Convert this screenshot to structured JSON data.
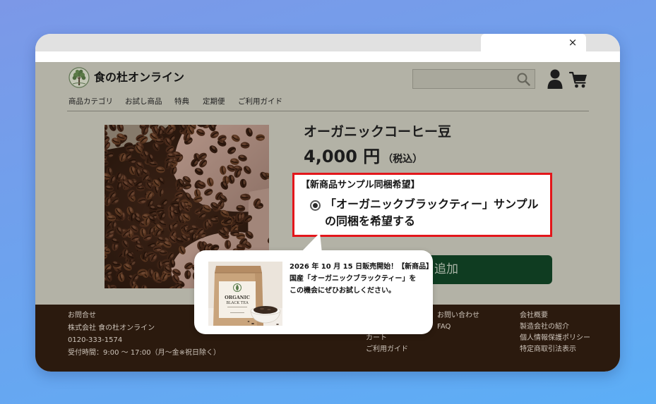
{
  "browser": {
    "close_glyph": "×",
    "close_icon": "close-icon"
  },
  "header": {
    "site_name": "食の杜オンライン",
    "logo_icon": "tree-logo-icon",
    "search_icon": "search-icon",
    "user_icon": "user-icon",
    "cart_icon": "cart-icon"
  },
  "nav": [
    {
      "label": "商品カテゴリ"
    },
    {
      "label": "お試し商品"
    },
    {
      "label": "特典"
    },
    {
      "label": "定期便"
    },
    {
      "label": "ご利用ガイド"
    }
  ],
  "product": {
    "title": "オーガニックコーヒー豆",
    "price": "4,000 円",
    "tax_note": "（税込）",
    "image": "coffee-beans-in-hands"
  },
  "sample_option": {
    "heading": "【新商品サンプル同梱希望】",
    "label_line1": "「オーガニックブラックティー」サンプル",
    "label_line2": "の同梱を希望する",
    "selected": true
  },
  "cart_button": {
    "label": "追加"
  },
  "callout": {
    "lines": [
      "2026 年 10 月 15 日販売開始！【新商品】",
      "国産「オーガニックブラックティー」を",
      "この機会にぜひお試しください。"
    ],
    "package_text": [
      "ORGANIC",
      "BLACK TEA"
    ]
  },
  "footer": {
    "contact": [
      "お問合せ",
      "株式会社 食の杜オンライン",
      "0120-333-1574",
      "受付時間：9:00 〜 17:00（月〜金※祝日除く）"
    ],
    "links_col2": [
      "カート",
      "ご利用ガイド"
    ],
    "links_col3": [
      "お問い合わせ",
      "FAQ"
    ],
    "links_col4": [
      "会社概要",
      "製造会社の紹介",
      "個人情報保護ポリシー",
      "特定商取引法表示"
    ]
  },
  "colors": {
    "bg_top": "#7c98e7",
    "bg_bottom": "#5caef6",
    "page_bg": "#b3b2a6",
    "footer_bg": "#2b1a0e",
    "footer_text": "#cbc2b8",
    "highlight_border": "#e3161b",
    "button_bg": "#0f3c21"
  }
}
